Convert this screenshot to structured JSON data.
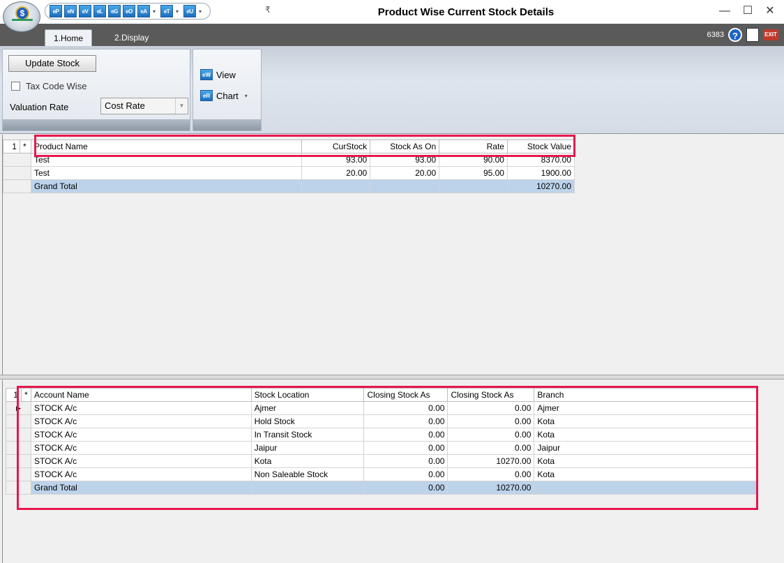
{
  "window": {
    "title": "Product Wise Current Stock Details",
    "controls": {
      "minimize": "—",
      "maximize": "☐",
      "close": "✕"
    }
  },
  "quick_access": {
    "buttons": [
      "eP",
      "eN",
      "eV",
      "eL",
      "eG",
      "eO",
      "eA",
      "eT",
      "eU"
    ],
    "dropdown_glyph": "▾",
    "more_glyph": "₹"
  },
  "tabs": [
    {
      "label": "1.Home",
      "active": true
    },
    {
      "label": "2.Display",
      "active": false
    }
  ],
  "status": {
    "user_id": "6383",
    "help_glyph": "?",
    "exit_label": "EXIT"
  },
  "ribbon": {
    "update_stock_label": "Update Stock",
    "tax_code_wise_label": "Tax Code Wise",
    "tax_code_wise_checked": false,
    "valuation_rate_label": "Valuation Rate",
    "valuation_rate_value": "Cost Rate",
    "view_label": "View",
    "view_icon": "eW",
    "chart_label": "Chart",
    "chart_icon": "eR"
  },
  "product_grid": {
    "corner": [
      "1",
      "*"
    ],
    "columns": [
      "Product Name",
      "CurStock",
      "Stock As On",
      "Rate",
      "Stock Value"
    ],
    "rows": [
      {
        "product": "Test",
        "cur_stock": "93.00",
        "stock_as_on": "93.00",
        "rate": "90.00",
        "value": "8370.00"
      },
      {
        "product": "Test",
        "cur_stock": "20.00",
        "stock_as_on": "20.00",
        "rate": "95.00",
        "value": "1900.00"
      }
    ],
    "total": {
      "label": "Grand Total",
      "cur_stock": "",
      "stock_as_on": "",
      "rate": "",
      "value": "10270.00"
    }
  },
  "account_grid": {
    "corner": [
      "1",
      "*"
    ],
    "columns": [
      "Account Name",
      "Stock Location",
      "Closing Stock As",
      "Closing Stock As",
      "Branch"
    ],
    "current_row_glyph": "▶",
    "rows": [
      {
        "account": "STOCK A/c",
        "location": "Ajmer",
        "closing1": "0.00",
        "closing2": "0.00",
        "branch": "Ajmer"
      },
      {
        "account": "STOCK A/c",
        "location": "Hold Stock",
        "closing1": "0.00",
        "closing2": "0.00",
        "branch": "Kota"
      },
      {
        "account": "STOCK A/c",
        "location": "In Transit Stock",
        "closing1": "0.00",
        "closing2": "0.00",
        "branch": "Kota"
      },
      {
        "account": "STOCK A/c",
        "location": "Jaipur",
        "closing1": "0.00",
        "closing2": "0.00",
        "branch": "Jaipur"
      },
      {
        "account": "STOCK A/c",
        "location": "Kota",
        "closing1": "0.00",
        "closing2": "10270.00",
        "branch": "Kota"
      },
      {
        "account": "STOCK A/c",
        "location": "Non Saleable Stock",
        "closing1": "0.00",
        "closing2": "0.00",
        "branch": "Kota"
      }
    ],
    "total": {
      "label": "Grand Total",
      "location": "",
      "closing1": "0.00",
      "closing2": "10270.00",
      "branch": ""
    }
  },
  "colors": {
    "highlight": "#e8174f",
    "total_row": "#bcd3ea",
    "tabstrip": "#5a5a5a"
  }
}
